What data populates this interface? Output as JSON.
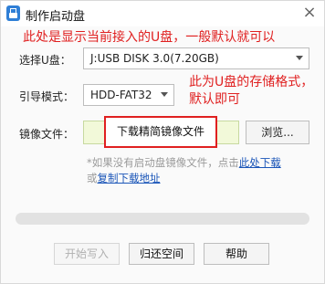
{
  "window": {
    "title": "制作启动盘",
    "close_glyph": "×"
  },
  "annotations": {
    "top": "此处是显示当前接入的U盘，一般默认就可以",
    "right": "此为U盘的存储格式，默认即可"
  },
  "form": {
    "usb_label": "选择U盘：",
    "usb_value": "J:USB DISK 3.0(7.20GB)",
    "boot_label": "引导模式：",
    "boot_value": "HDD-FAT32",
    "image_label": "镜像文件：",
    "download_image_label": "下载精简镜像文件",
    "browse_label": "浏览..."
  },
  "hint": {
    "prefix": "*如果没有启动盘镜像文件，点击",
    "link1": "此处下载",
    "middle": "或",
    "link2": "复制下载地址"
  },
  "progress": {
    "value": 0
  },
  "buttons": {
    "start": "开始写入",
    "restore": "归还空间",
    "help": "帮助"
  },
  "colors": {
    "annotation": "#e02020",
    "link": "#1a55b8",
    "image_field_bg": "#f2f9d9",
    "app_icon": "#2f7fd6"
  },
  "icons": {
    "app": "usb-drive-icon",
    "close": "close-icon",
    "dropdown": "chevron-down-icon"
  }
}
